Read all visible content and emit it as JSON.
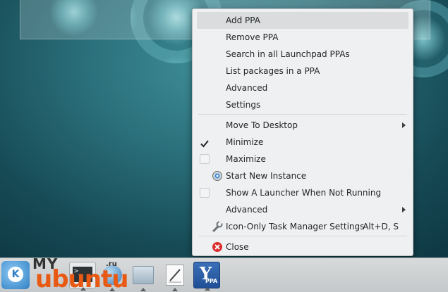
{
  "context_menu": {
    "items": [
      {
        "label": "Add PPA",
        "highlighted": true
      },
      {
        "label": "Remove PPA"
      },
      {
        "label": "Search in all Launchpad PPAs"
      },
      {
        "label": "List packages in a PPA"
      },
      {
        "label": "Advanced"
      },
      {
        "label": "Settings"
      }
    ],
    "items2": [
      {
        "label": "Move To Desktop",
        "submenu": true
      },
      {
        "label": "Minimize",
        "checked": true
      },
      {
        "label": "Maximize",
        "checked": false
      },
      {
        "label": "Start New Instance",
        "icon": "new-instance-icon"
      },
      {
        "label": "Show A Launcher When Not Running",
        "checked": false
      },
      {
        "label": "Advanced",
        "submenu": true
      },
      {
        "label": "Icon-Only Task Manager Settings",
        "icon": "wrench-icon",
        "shortcut": "Alt+D, S"
      }
    ],
    "items3": [
      {
        "label": "Close",
        "icon": "close-icon"
      }
    ]
  },
  "taskbar": {
    "launcher_letter": "K",
    "watermark": {
      "top": "MY",
      "bottom": "ubuntu"
    },
    "terminal_prompt": ">_",
    "globe_label": ".ru",
    "ppa_letter": "Y",
    "ppa_text": "PPA"
  },
  "colors": {
    "menu_bg": "#eff0f1",
    "highlight": "#dadcde",
    "close_red": "#da2d2d",
    "watermark_orange": "#e85a13"
  }
}
